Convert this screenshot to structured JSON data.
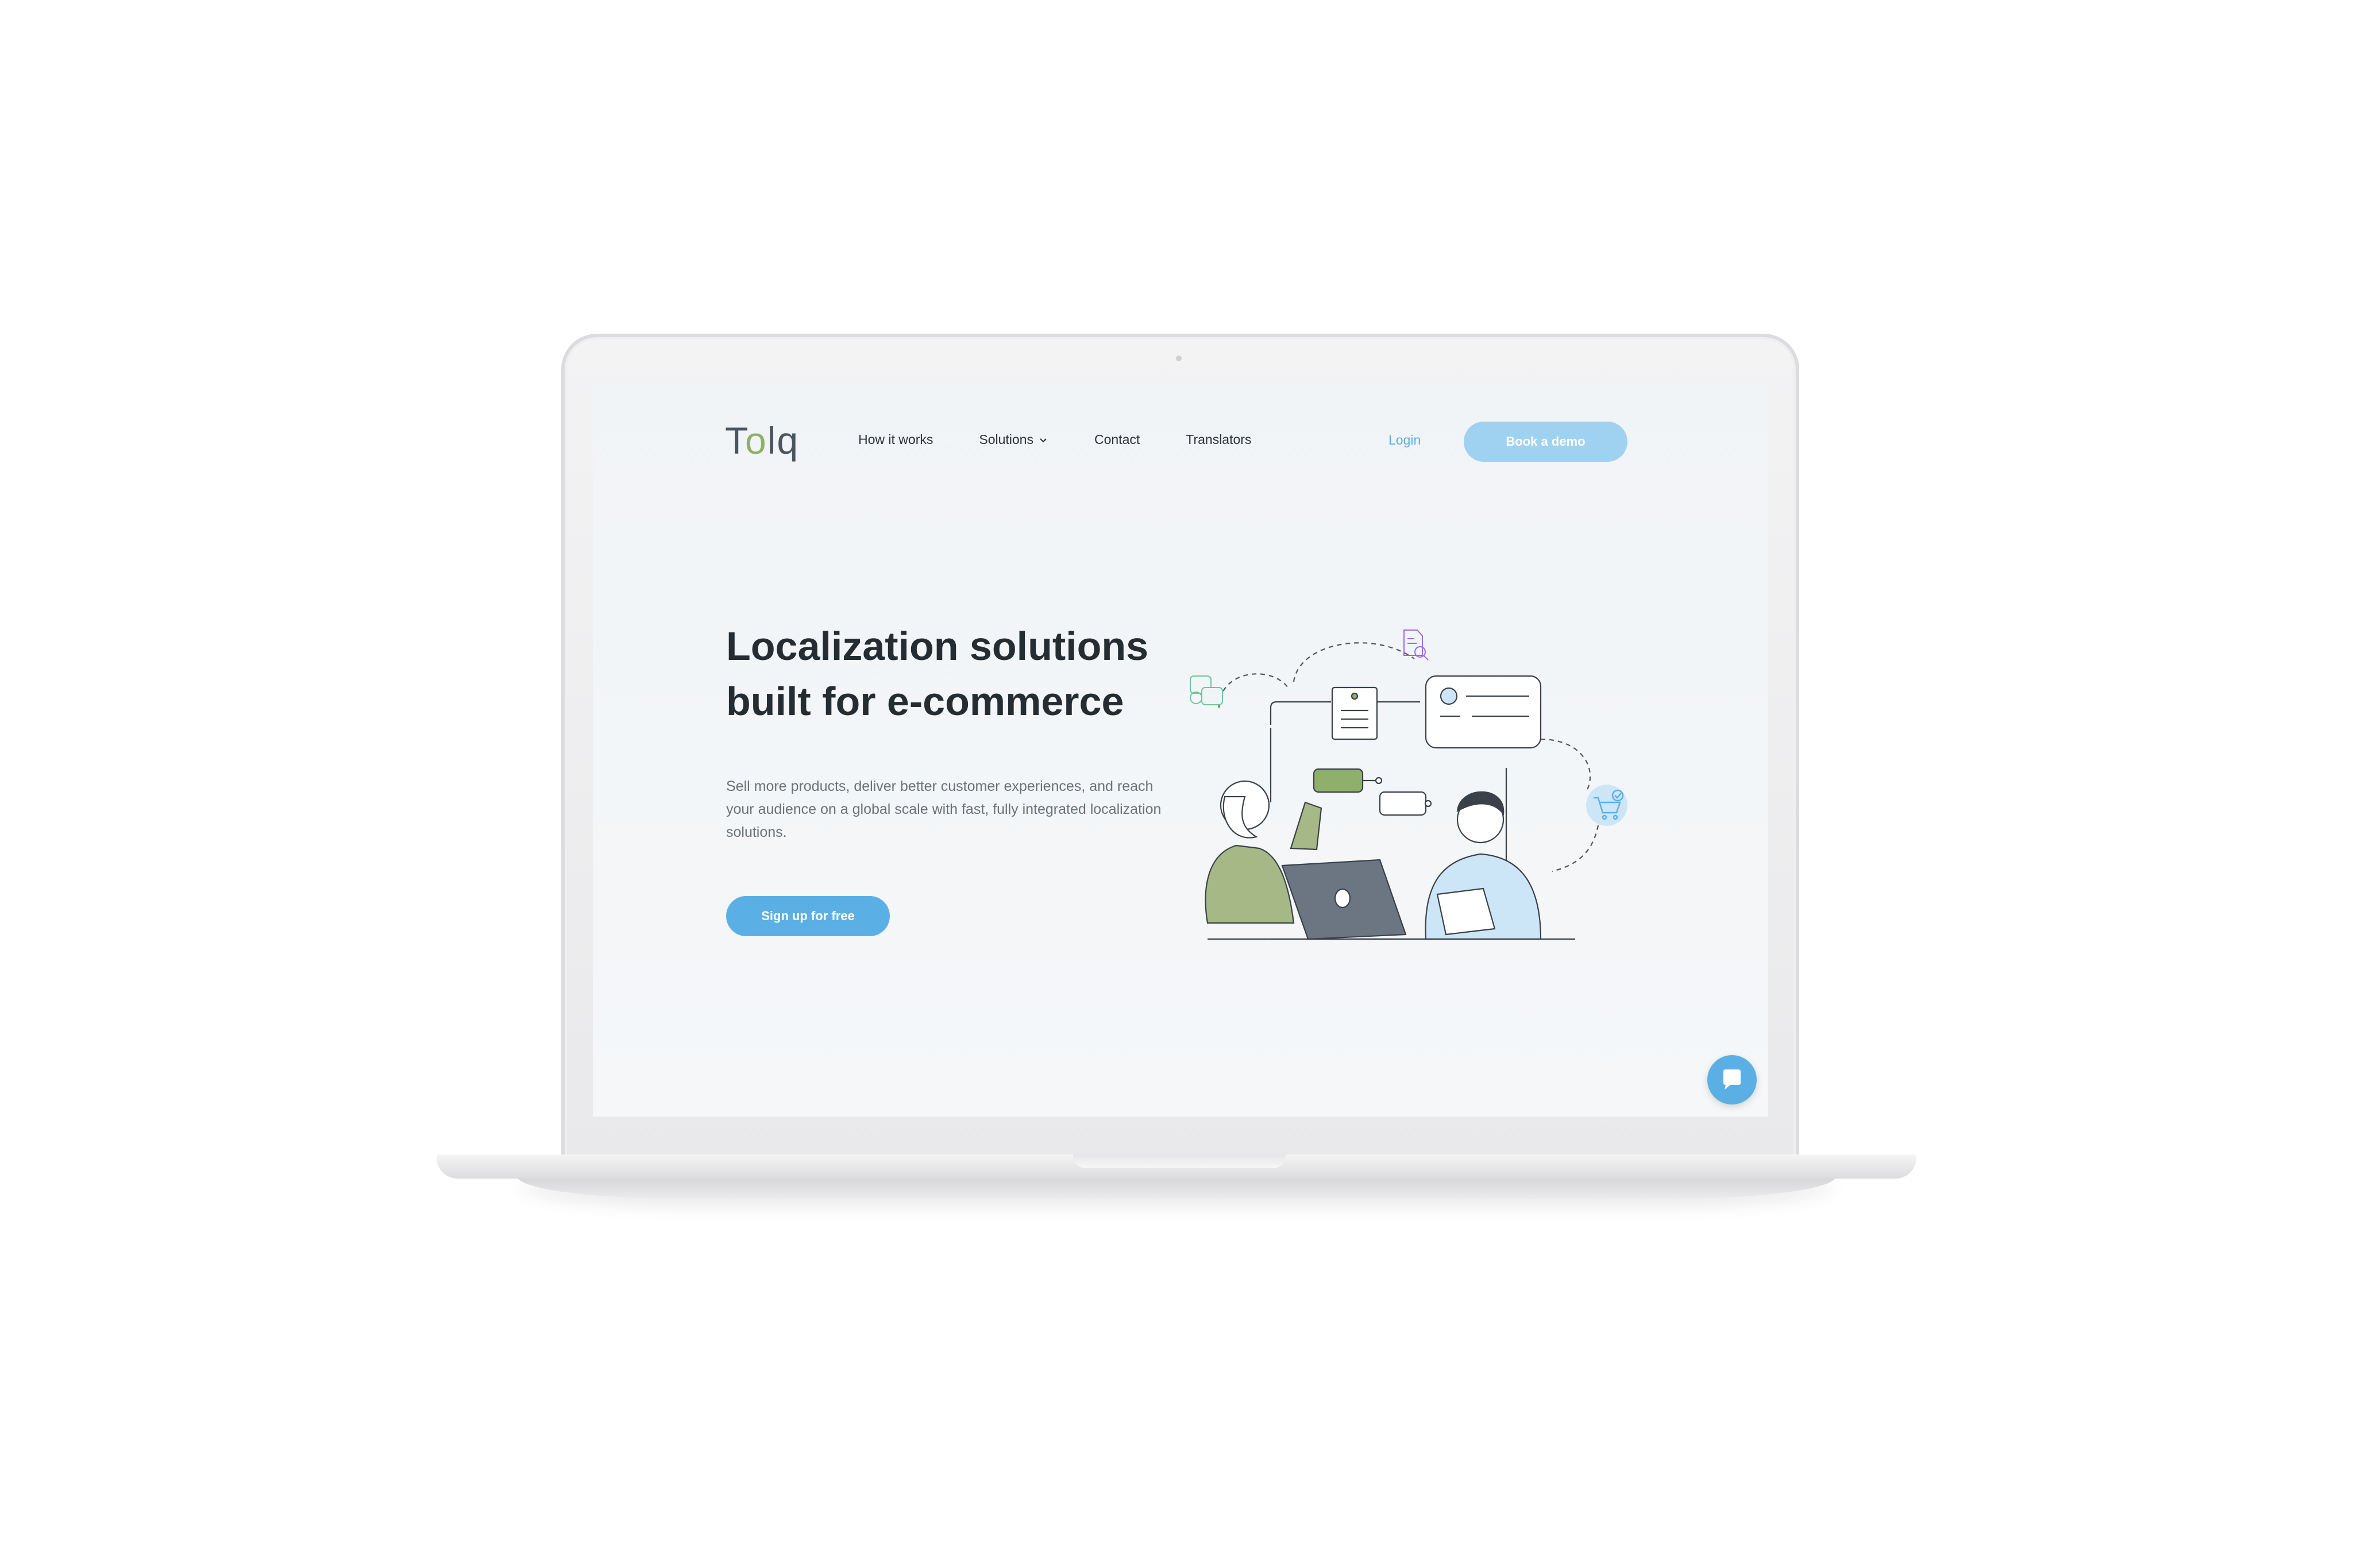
{
  "brand": {
    "logo_prefix": "T",
    "logo_o": "o",
    "logo_suffix": "lq"
  },
  "nav": {
    "items": [
      {
        "label": "How it works"
      },
      {
        "label": "Solutions"
      },
      {
        "label": "Contact"
      },
      {
        "label": "Translators"
      }
    ],
    "login_label": "Login",
    "demo_label": "Book a demo"
  },
  "hero": {
    "title_line1": "Localization solutions",
    "title_line2": "built for e-commerce",
    "description": "Sell more products, deliver better customer experiences, and reach your audience on a global scale with fast, fully integrated localization solutions.",
    "cta_label": "Sign up for free"
  },
  "icons": {
    "dropdown": "chevron-down-icon",
    "chat": "chat-bubble-icon",
    "translate": "translate-icon",
    "document_search": "document-search-icon",
    "cart": "cart-check-icon"
  },
  "colors": {
    "accent": "#5ab0e4",
    "accent_light": "#9fd2f0",
    "logo_green": "#8fb06a",
    "heading": "#252d33",
    "body_text": "#6b7378"
  }
}
